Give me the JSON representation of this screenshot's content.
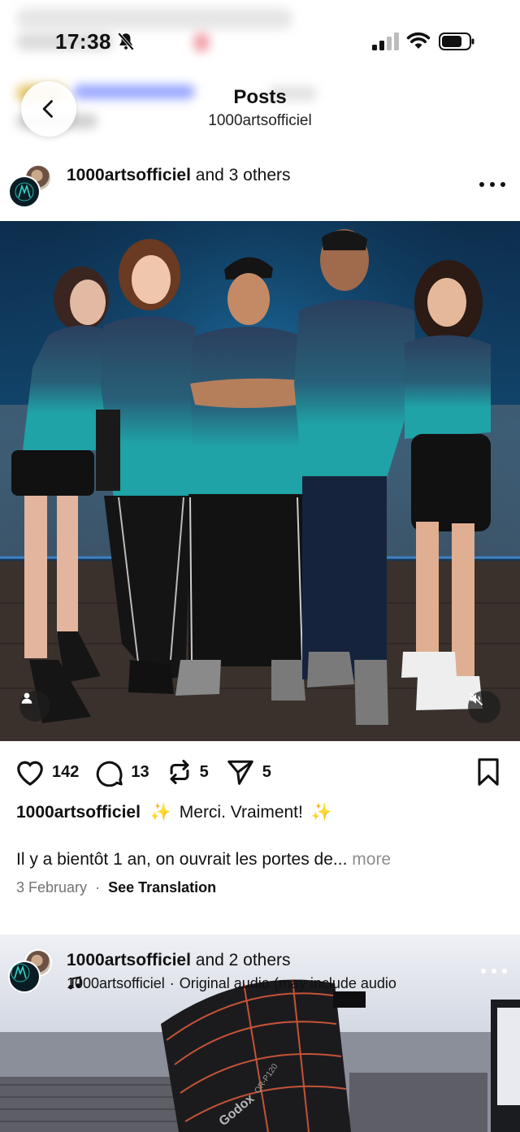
{
  "status_bar": {
    "time": "17:38",
    "icons": [
      "bell-slash-icon",
      "cellular-signal-icon",
      "wifi-icon",
      "battery-icon"
    ]
  },
  "header": {
    "title": "Posts",
    "subtitle": "1000artsofficiel",
    "back_icon": "chevron-left-icon"
  },
  "post": {
    "author": "1000artsofficiel",
    "coauthors": "and 3 others",
    "photo_overlay_icons": [
      "person-tag-icon",
      "speaker-muted-icon"
    ],
    "likes": "142",
    "comments": "13",
    "reposts": "5",
    "shares": "5",
    "caption_author": "1000artsofficiel",
    "caption_sparkle": "✨",
    "caption_text": "Merci. Vraiment!",
    "caption_body": "Il y a bientôt 1 an, on ouvrait les portes de...",
    "more_label": "more",
    "date": "3 February",
    "separator": "·",
    "see_translation": "See Translation"
  },
  "next_post": {
    "author": "1000artsofficiel",
    "coauthors": "and 2 others",
    "audio_author": "1000artsofficiel",
    "separator": "·",
    "audio_title": "Original audio (may include audio"
  },
  "colors": {
    "text": "#111111",
    "muted": "#737373",
    "jersey_teal": "#1fa3a6",
    "jersey_navy": "#2a3f5c",
    "backdrop_blue": "#134a73"
  }
}
